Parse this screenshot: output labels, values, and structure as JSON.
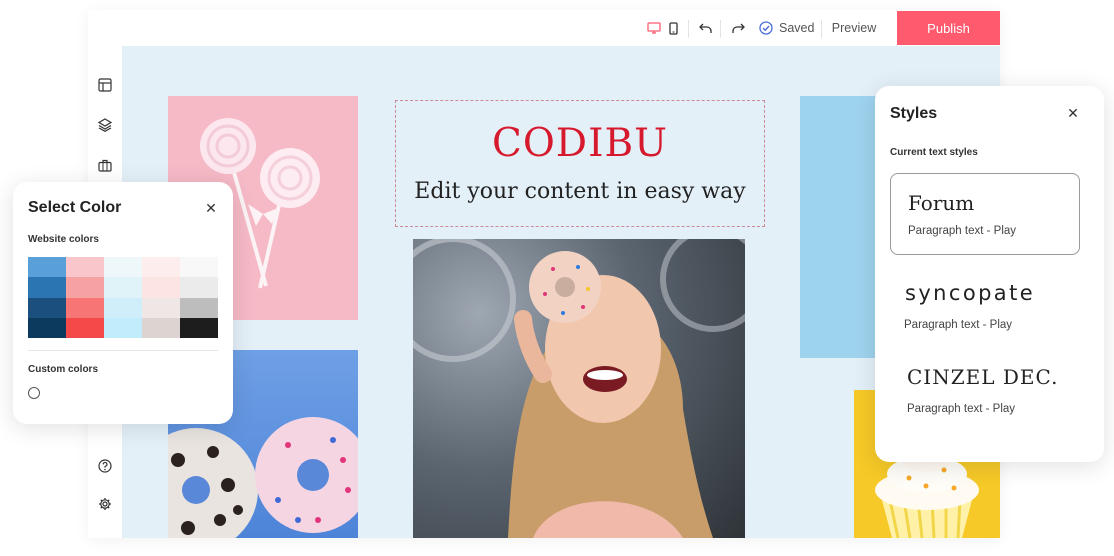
{
  "toolbar": {
    "desktop_icon": "desktop-icon",
    "mobile_icon": "mobile-icon",
    "undo_icon": "undo-icon",
    "redo_icon": "redo-icon",
    "saved_label": "Saved",
    "preview_label": "Preview",
    "publish_label": "Publish"
  },
  "sidebar": {
    "items": [
      {
        "icon": "layout-icon"
      },
      {
        "icon": "layers-icon"
      },
      {
        "icon": "briefcase-icon"
      },
      {
        "icon": "help-icon"
      },
      {
        "icon": "settings-icon"
      }
    ]
  },
  "hero": {
    "brand": "CODIBU",
    "tagline": "Edit your content in easy way"
  },
  "color_panel": {
    "title": "Select Color",
    "website_colors_label": "Website colors",
    "custom_colors_label": "Custom colors",
    "swatches": [
      [
        "#5aa0d8",
        "#f9c7cb",
        "#eef8fb",
        "#fdeeed",
        "#f8f8f8"
      ],
      [
        "#2c75b3",
        "#f6a2a2",
        "#e0f3f9",
        "#fbe4e1",
        "#ebebeb"
      ],
      [
        "#1a4f7e",
        "#f87575",
        "#cfeefa",
        "#efe7e5",
        "#bdbdbd"
      ],
      [
        "#0b3a5e",
        "#f54848",
        "#c1ecfb",
        "#ddd4d1",
        "#1d1d1d"
      ]
    ]
  },
  "styles_panel": {
    "title": "Styles",
    "current_label": "Current text styles",
    "styles": [
      {
        "font": "Forum",
        "paragraph": "Paragraph text - Play"
      },
      {
        "font": "syncopate",
        "paragraph": "Paragraph text - Play"
      },
      {
        "font": "CINZEL DEC.",
        "paragraph": "Paragraph text - Play"
      }
    ]
  },
  "colors": {
    "accent": "#ff5a6e",
    "brand_red": "#d7192d",
    "canvas_bg": "#e4f0f8",
    "saved_check": "#4a6fd6"
  }
}
